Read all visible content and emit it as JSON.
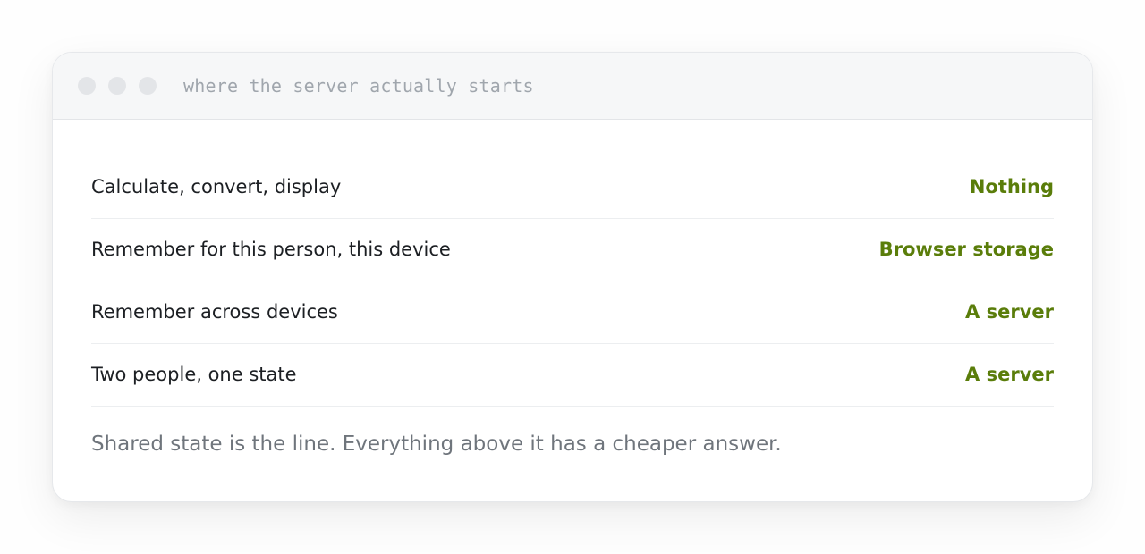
{
  "window": {
    "title": "where the server actually starts"
  },
  "rows": [
    {
      "label": "Calculate, convert, display",
      "value": "Nothing"
    },
    {
      "label": "Remember for this person, this device",
      "value": "Browser storage"
    },
    {
      "label": "Remember across devices",
      "value": "A server"
    },
    {
      "label": "Two people, one state",
      "value": "A server"
    }
  ],
  "footnote": "Shared state is the line. Everything above it has a cheaper answer.",
  "colors": {
    "accent": "#5a7d0a",
    "titlebar": "#f6f7f8",
    "muted_text": "#6f757c"
  }
}
